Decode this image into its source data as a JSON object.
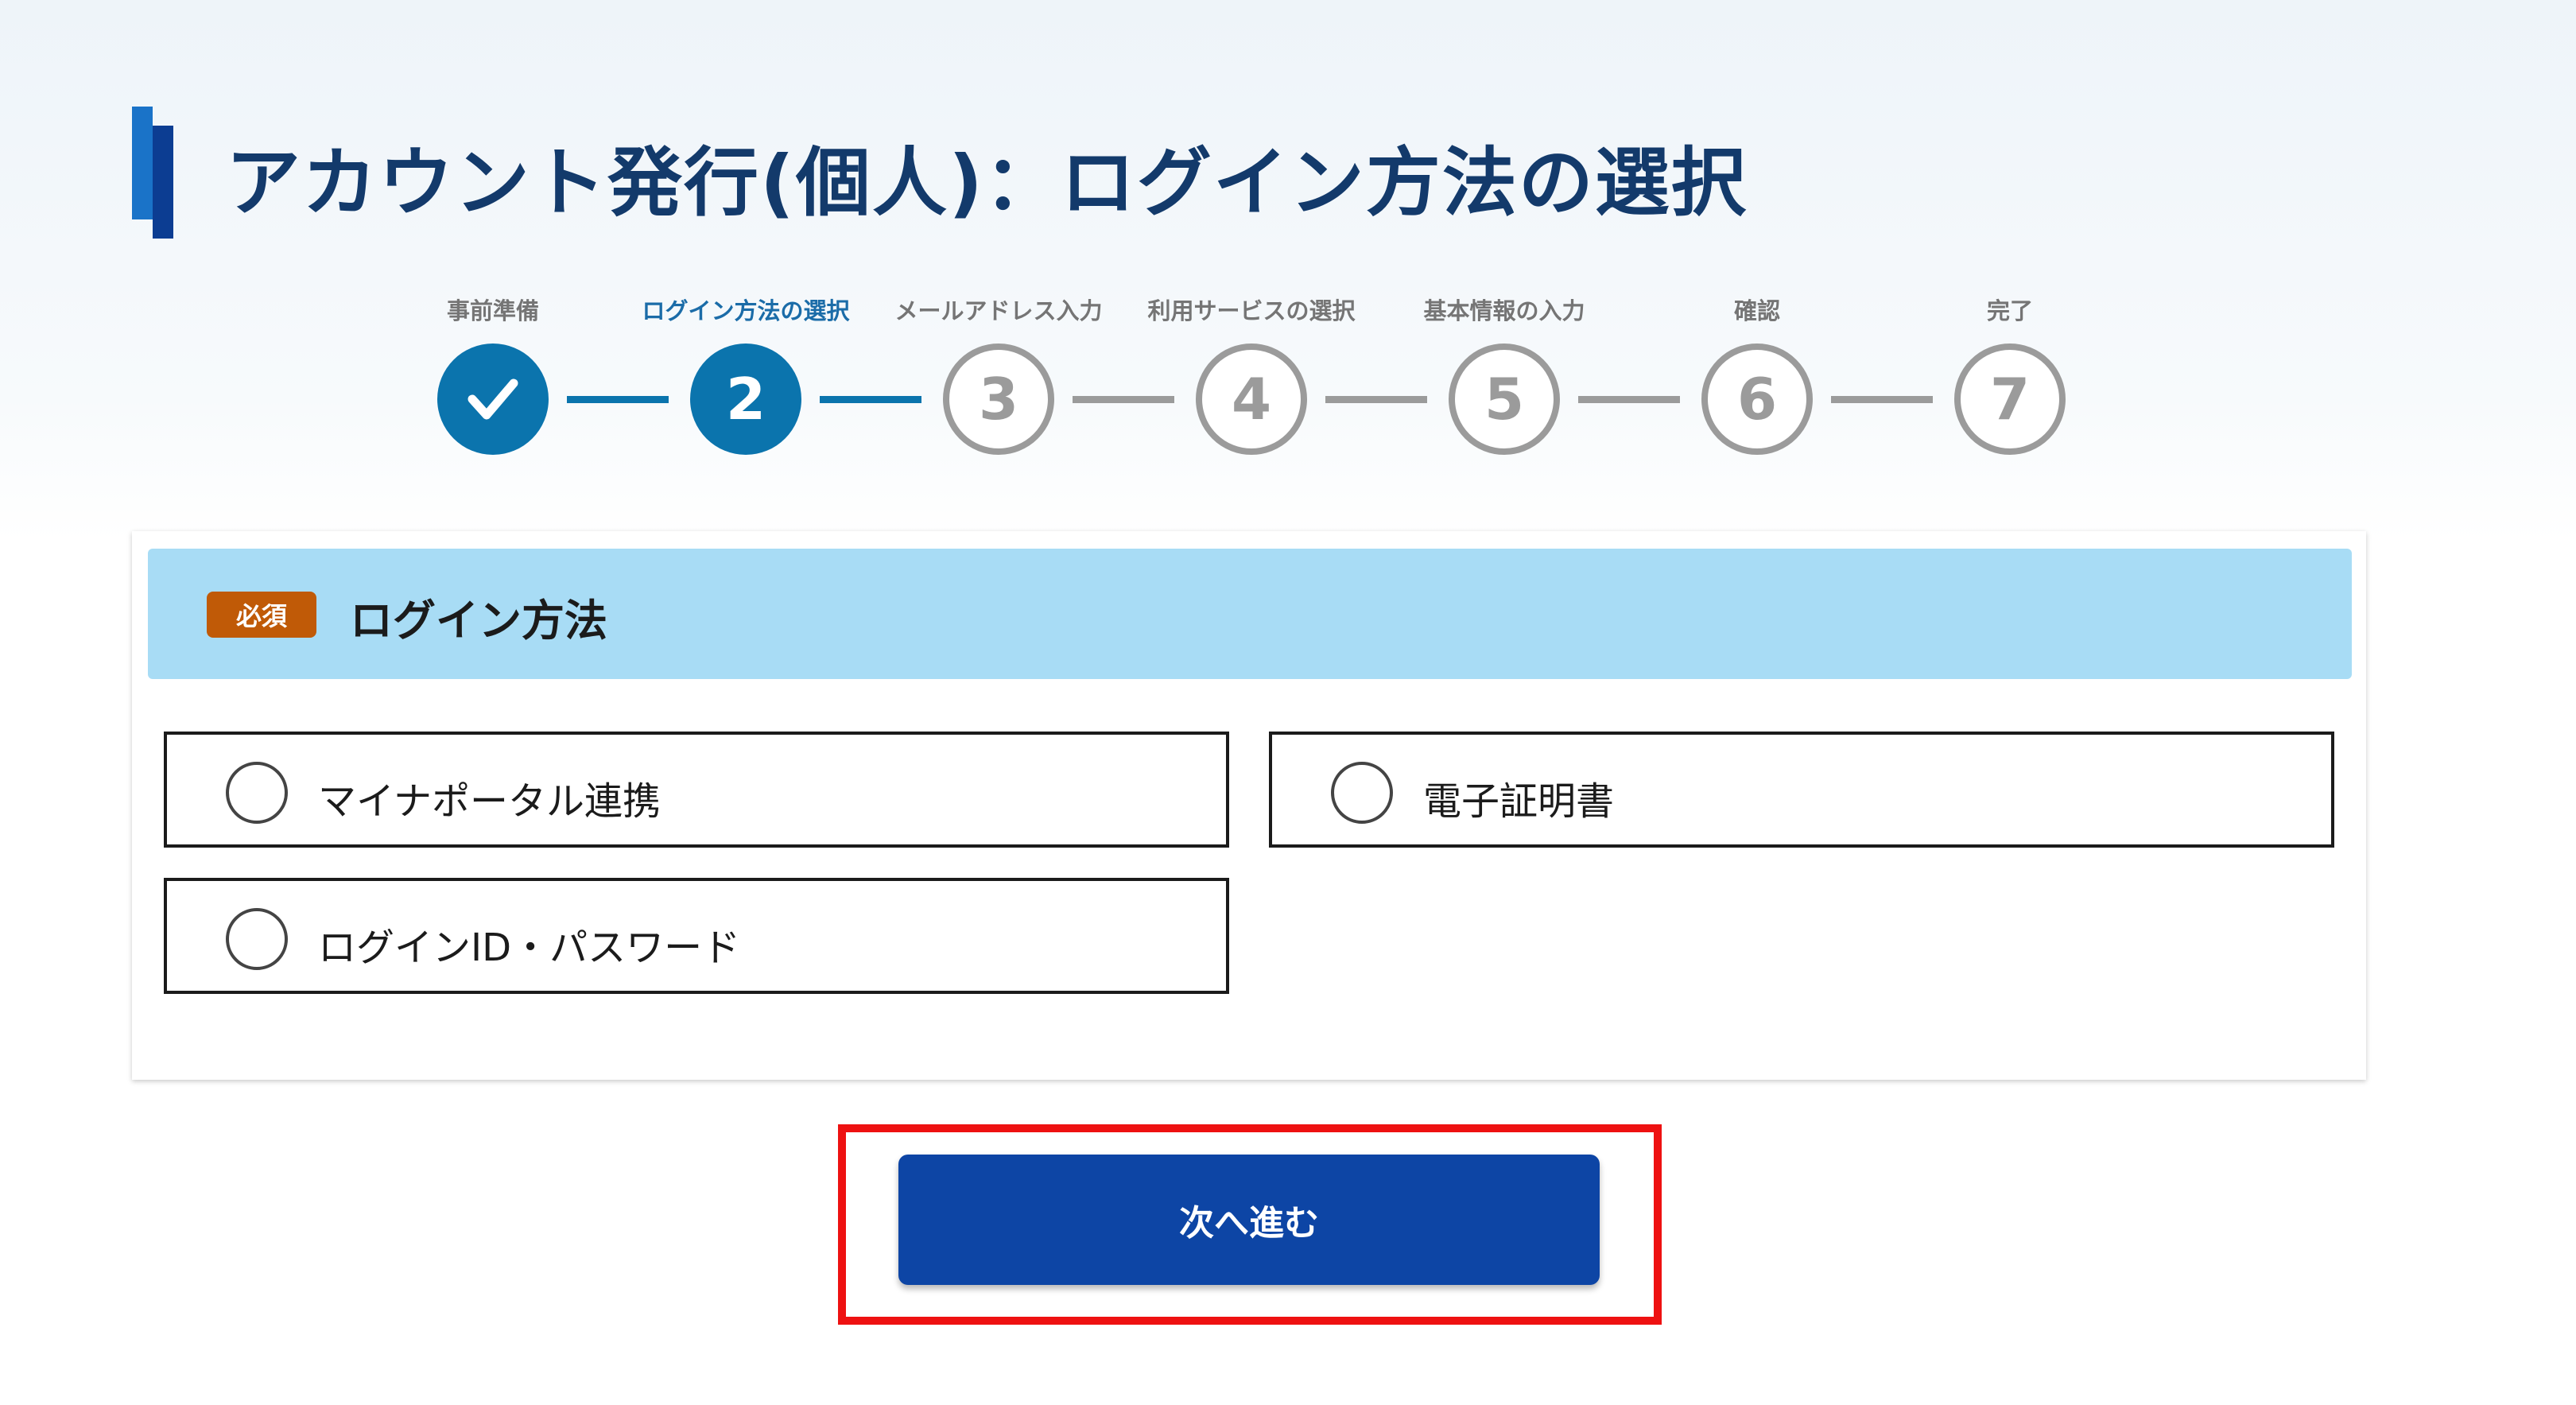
{
  "page": {
    "title": "アカウント発行(個人)：ログイン方法の選択"
  },
  "stepper": {
    "steps": [
      {
        "label": "事前準備",
        "number": "",
        "status": "done"
      },
      {
        "label": "ログイン方法の選択",
        "number": "2",
        "status": "current"
      },
      {
        "label": "メールアドレス入力",
        "number": "3",
        "status": "todo"
      },
      {
        "label": "利用サービスの選択",
        "number": "4",
        "status": "todo"
      },
      {
        "label": "基本情報の入力",
        "number": "5",
        "status": "todo"
      },
      {
        "label": "確認",
        "number": "6",
        "status": "todo"
      },
      {
        "label": "完了",
        "number": "7",
        "status": "todo"
      }
    ],
    "current_step": 2,
    "total_steps": 7
  },
  "login_section": {
    "required_badge": "必須",
    "title": "ログイン方法",
    "options": [
      {
        "label": "マイナポータル連携",
        "selected": false
      },
      {
        "label": "電子証明書",
        "selected": false
      },
      {
        "label": "ログインID・パスワード",
        "selected": false
      }
    ]
  },
  "actions": {
    "next_label": "次へ進む"
  },
  "icons": {
    "done_step": "check-icon",
    "option_control": "radio-button"
  },
  "colors": {
    "title_text": "#133a6b",
    "step_active": "#0b74ad",
    "step_inactive": "#9b9b9b",
    "section_header_bg": "#a8dcf5",
    "required_badge_bg": "#c05a07",
    "primary_button": "#0d45a5",
    "highlight_border": "#ee1111"
  }
}
